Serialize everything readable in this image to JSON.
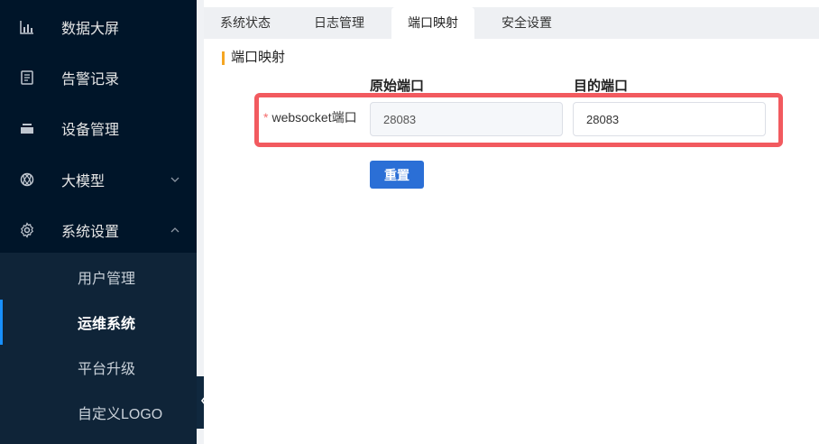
{
  "sidebar": {
    "items": [
      {
        "label": "数据大屏",
        "icon": "bar-chart-icon"
      },
      {
        "label": "告警记录",
        "icon": "document-icon"
      },
      {
        "label": "设备管理",
        "icon": "device-icon"
      },
      {
        "label": "大模型",
        "icon": "ai-model-icon"
      },
      {
        "label": "系统设置",
        "icon": "gear-icon"
      }
    ],
    "submenu": [
      {
        "label": "用户管理"
      },
      {
        "label": "运维系统"
      },
      {
        "label": "平台升级"
      },
      {
        "label": "自定义LOGO"
      }
    ],
    "active_submenu": "运维系统"
  },
  "tabs": [
    {
      "label": "系统状态"
    },
    {
      "label": "日志管理"
    },
    {
      "label": "端口映射"
    },
    {
      "label": "安全设置"
    }
  ],
  "active_tab": "端口映射",
  "section": {
    "title": "端口映射",
    "col_source": "原始端口",
    "col_target": "目的端口"
  },
  "form": {
    "required_mark": "*",
    "label": "websocket端口",
    "source_value": "28083",
    "target_value": "28083",
    "reset_label": "重置"
  },
  "colors": {
    "sidebar_bg": "#001529",
    "accent": "#2b6fd6",
    "highlight": "#f25a5f",
    "section_marker": "#f5a623"
  }
}
